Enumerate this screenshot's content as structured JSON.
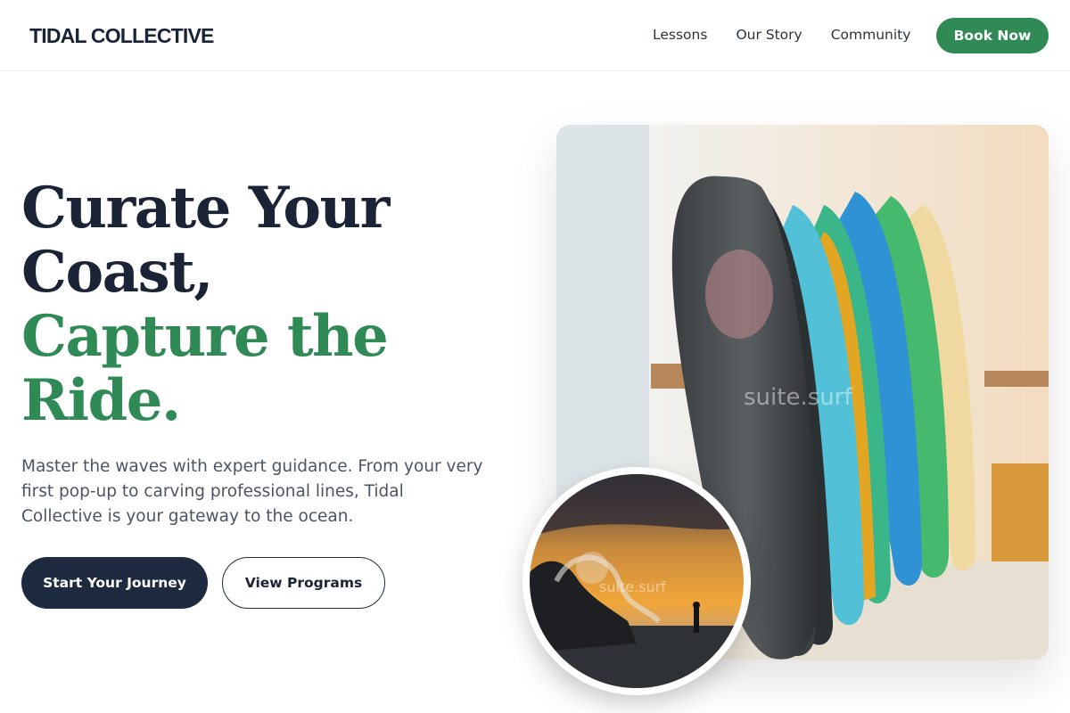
{
  "nav": {
    "brand": "TIDAL COLLECTIVE",
    "links": [
      "Lessons",
      "Our Story",
      "Community"
    ],
    "cta": "Book Now"
  },
  "hero": {
    "headline_dark": [
      "Curate Your",
      "Coast,"
    ],
    "headline_green": [
      "Capture the",
      "Ride."
    ],
    "lead": "Master the waves with expert guidance. From your very first pop-up to carving professional lines, Tidal Collective is your gateway to the ocean.",
    "primary_cta": "Start Your Journey",
    "secondary_cta": "View Programs",
    "image_watermark": "suite.surf",
    "circle_watermark": "suite.surf"
  },
  "colors": {
    "accent_green": "#2f8a56",
    "navy": "#1e2a3f"
  }
}
